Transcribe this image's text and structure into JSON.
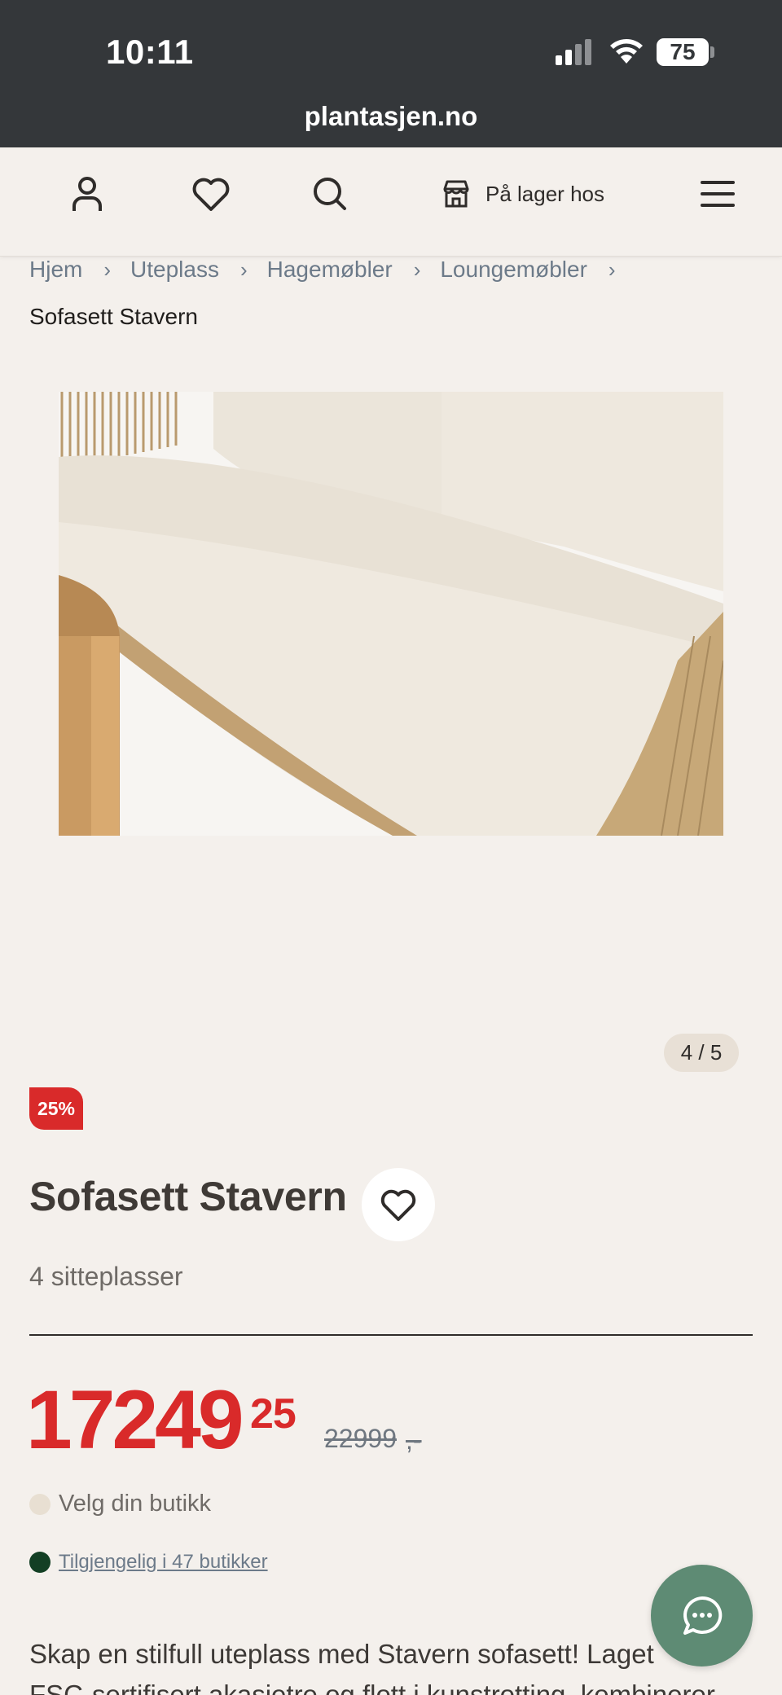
{
  "status_bar": {
    "time": "10:11",
    "battery": "75"
  },
  "browser": {
    "url": "plantasjen.no"
  },
  "header": {
    "store_label": "På lager hos",
    "icons": [
      "account-icon",
      "heart-icon",
      "search-icon",
      "store-icon",
      "menu-icon"
    ]
  },
  "breadcrumb": {
    "items": [
      "Hjem",
      "Uteplass",
      "Hagemøbler",
      "Loungemøbler"
    ],
    "current": "Sofasett Stavern"
  },
  "gallery": {
    "counter": "4 / 5"
  },
  "product": {
    "discount_badge": "25%",
    "title": "Sofasett Stavern",
    "subtitle": "4 sitteplasser",
    "price_main": "17249",
    "price_cents": "25",
    "price_old": "22999",
    "price_old_suffix": ",-",
    "store_prompt": "Velg din butikk",
    "availability": "Tilgjengelig i 47 butikker",
    "description_line1": "Skap en stilfull uteplass med Stavern sofasett! Laget",
    "description_line2": "FSC-sertifisert akasietre og flott i kunstrotting, kombinerer"
  },
  "colors": {
    "accent_red": "#d92a2a",
    "chat_green": "#5e8b74",
    "available_green": "#133f24",
    "header_dark": "#34373a"
  }
}
